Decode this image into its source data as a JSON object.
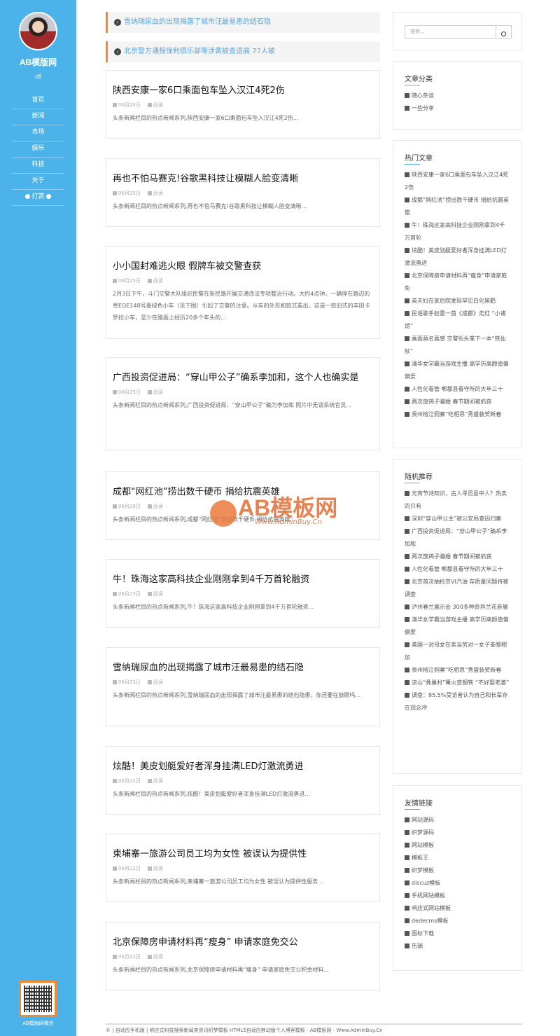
{
  "sidebar": {
    "site_name": "AB模版网",
    "site_sub": "df",
    "nav": [
      "首页",
      "新闻",
      "市场",
      "娱乐",
      "科技",
      "关于",
      "打赏"
    ],
    "qr_label": "AB模版网微信"
  },
  "notices": [
    "雪纳瑞尿血的出现揭露了城市汪最易患的结石隐",
    "北京警方通报保利俱乐部等涉黄被查退展 77人被"
  ],
  "posts": [
    {
      "title": "陕西安康一家6口乘面包车坠入汉江4死2伤",
      "date": "06月20日",
      "category": "品读",
      "excerpt": "头条新闻栏目的热点新闻系列,陕西安康一家6口乘面包车坠入汉江4死2伤..."
    },
    {
      "title": "再也不怕马赛克!谷歌黑科技让模糊人脸变清晰",
      "date": "06月25日",
      "category": "品读",
      "excerpt": "头条新闻栏目的热点新闻系列,再也不怕马赛克!谷歌黑科技让模糊人脸变清晰..."
    },
    {
      "title": "小小国封难逃火眼 假牌车被交警查获",
      "date": "06月25日",
      "category": "品读",
      "excerpt": "2月3日下午，斗门交警大队组织民警在新民路开展交通违法专项整治行动。大约4点钟，一辆停在路边的粤EQE148号墨绿色小车（见下图）引起了交警的注意。从车的外形和款式看出，这是一款旧式的丰田卡罗拉小车，至少在路面上经历20多个年头的..."
    },
    {
      "title": "广西投资促进局：“穿山甲公子”确系李加和，这个人也确实是",
      "date": "06月25日",
      "category": "品读",
      "excerpt": "头条新闻栏目的热点新闻系列,广西投资促进局：“穿山甲公子”确为李加和 照片中无误系统官员..."
    },
    {
      "title": "成都“网红池”捞出数千硬币 捐给抗震英雄",
      "date": "06月29日",
      "category": "品读",
      "excerpt": "头条新闻栏目的热点新闻系列,成都“网红池”捞出数千硬币 捐给抗震英雄..."
    },
    {
      "title": "牛！珠海这家高科技企业刚刚拿到4千万首轮融资",
      "date": "06月23日",
      "category": "品读",
      "excerpt": "头条新闻栏目的热点新闻系列,牛！珠海这家高科技企业刚刚拿到4千万首轮融资..."
    },
    {
      "title": "雪纳瑞尿血的出现揭露了城市汪最易患的结石隐",
      "date": "06月23日",
      "category": "品读",
      "excerpt": "头条新闻栏目的热点新闻系列,雪纳瑞尿血的出现揭露了城市汪最易患的结石隐患，你还要在鼓眼吗..."
    },
    {
      "title": "炫酷！美皮划艇爱好者浑身挂满LED灯激流勇进",
      "date": "06月12日",
      "category": "品读",
      "excerpt": "头条新闻栏目的热点新闻系列,炫酷！美皮划艇爱好者浑身挂满LED灯激流勇进..."
    },
    {
      "title": "柬埔寨一旅游公司员工均为女性 被误认为提供性",
      "date": "06月22日",
      "category": "品读",
      "excerpt": "头条新闻栏目的热点新闻系列,柬埔寨一旅游公司员工均为女性 被误认为提供性服务..."
    },
    {
      "title": "北京保障房申请材料再“瘦身” 申请家庭免交公",
      "date": "06月22日",
      "category": "品读",
      "excerpt": "头条新闻栏目的热点新闻系列,北京保障房申请材料再“瘦身” 申请家庭免交公积金材料..."
    }
  ],
  "search": {
    "placeholder": "搜索..."
  },
  "categories": {
    "title": "文章分类",
    "items": [
      "随心杂谈",
      "一些分享"
    ]
  },
  "hot": {
    "title": "热门文章",
    "items": [
      "陕西安康一家6口乘面包车坠入汉江4死2伤",
      "成都“网红池”捞出数千硬币 捐给抗震英雄",
      "牛！珠海这家高科技企业刚刚拿到4千万首轮",
      "炫酷！美皮划艇爱好者浑身挂满LED灯激流勇进",
      "北京保障房申请材料再“瘦身”申请家庭免",
      "英夫妇在家后院发现罕见白化黑鹳",
      "民谣歌手赵雷一首《成都》走红 “小诸馆”",
      "画面莫名喜感 交警街头拿下一本“铁仙杖”",
      "清华女学霸当游戏主播 高学历高颜值偏偏爱",
      "人性化看管 郫都县看守所的大年三十",
      "两次放鸽子骗婚 春节期间被抓获",
      "贵州榕江侗寨“吃相思”秀盛装贺新春"
    ]
  },
  "random": {
    "title": "随机推荐",
    "items": [
      "元宵节诗知识，古人寻觅意中人？热卖的只有",
      "深圳“穿山甲公主”被公安局查因归案",
      "广西投资促进局：“穿山甲公子”确系李加和",
      "两次放鸽子骗婚 春节期间被抓获",
      "人性化看管 郫都县看守所的大年三十",
      "北京首次抽检京VI汽油 存质量问题将被调查",
      "泸州春兰展示会 300多种奇异兰花参展",
      "清华女学霸当游戏主播 高学历高颜值偏偏爱",
      "美国一对母女在卖当劳对一女子拳脚相加",
      "贵州榕江侗寨“吃相思”秀盛装贺新春",
      "凉山“彝巢村”篝火变钢铁 “不好娶老婆”",
      "调查：85.5%受访者认为自己和长辈存在观念冲"
    ]
  },
  "links": {
    "title": "友情链接",
    "items": [
      "网站源码",
      "织梦源码",
      "网站模板",
      "模板王",
      "织梦模板",
      "discuz模板",
      "手机网站模板",
      "响应式网站模板",
      "dedecms模板",
      "图标下载",
      "告瑞"
    ]
  },
  "footer": {
    "text": "© | 自适应手机版 | 响应式科技搜索新闻类资讯织梦模板 HTML5自适应移动版个人博客模板 - AB模板网 - Www.AdminBuy.Cn"
  },
  "watermark": {
    "title": "AB模板网",
    "url": "Www.AdminBuy.Cn"
  },
  "colors": {
    "sidebar": "#4bb3ea",
    "accent": "#f28b2f",
    "notice_text": "#56a6e2"
  }
}
